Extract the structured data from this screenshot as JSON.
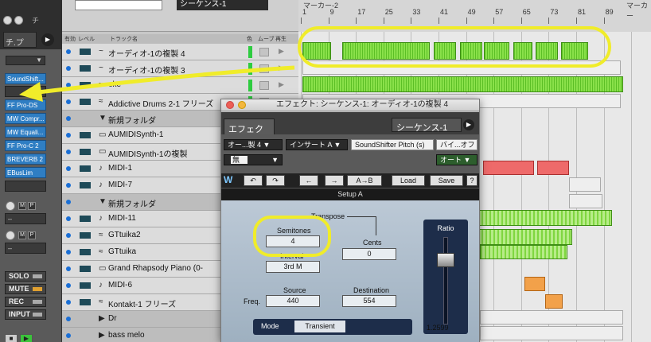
{
  "inspector": {
    "title": "チ",
    "tab_label": "チ.プ",
    "tab_btn": "▶",
    "dropdown": "▼",
    "plugins": [
      "SoundShift...",
      "FF Pro-DS",
      "MW Compr...",
      "MW Equali...",
      "FF Pro-C 2",
      "BREVERB 2",
      "EBusLim"
    ],
    "mini_buttons": [
      "M",
      "P"
    ],
    "dash_fields": [
      "–",
      "–"
    ],
    "status_buttons": [
      "SOLO",
      "MUTE",
      "REC",
      "INPUT"
    ],
    "transport": [
      "■",
      "▶"
    ]
  },
  "topbar": {
    "sequence": "シーケンス-1",
    "marker1": "マーカー-2",
    "marker2": "マーカー"
  },
  "ruler": {
    "bars": [
      "1",
      "9",
      "17",
      "25",
      "33",
      "41",
      "49",
      "57",
      "65",
      "73",
      "81",
      "89"
    ]
  },
  "columns": {
    "active": "有効",
    "level": "レベル",
    "name": "トラック名",
    "color": "色",
    "move": "ムーブ",
    "play": "再生"
  },
  "tracks": [
    {
      "icon": "~",
      "name": "オーディオ-1の複製 4",
      "folder": false
    },
    {
      "icon": "~",
      "name": "オーディオ-1の複製 3",
      "folder": false
    },
    {
      "icon": "≈",
      "name": "oke",
      "folder": false
    },
    {
      "icon": "≈",
      "name": "Addictive Drums 2-1 フリーズ",
      "folder": false
    },
    {
      "icon": "▼",
      "name": "新規フォルダ",
      "folder": true
    },
    {
      "icon": "▭",
      "name": "AUMIDISynth-1",
      "folder": false
    },
    {
      "icon": "▭",
      "name": "AUMIDISynth-1の複製",
      "folder": false
    },
    {
      "icon": "♪",
      "name": "MIDI-1",
      "folder": false
    },
    {
      "icon": "♪",
      "name": "MIDI-7",
      "folder": false
    },
    {
      "icon": "▼",
      "name": "新規フォルダ",
      "folder": true
    },
    {
      "icon": "♪",
      "name": "MIDI-11",
      "folder": false
    },
    {
      "icon": "≈",
      "name": "GTtuika2",
      "folder": false
    },
    {
      "icon": "≈",
      "name": "GTtuika",
      "folder": false
    },
    {
      "icon": "▭",
      "name": "Grand Rhapsody Piano (0-",
      "folder": false
    },
    {
      "icon": "♪",
      "name": "MIDI-6",
      "folder": false
    },
    {
      "icon": "≈",
      "name": "Kontakt-1 フリーズ",
      "folder": false
    },
    {
      "icon": "▶",
      "name": "Dr",
      "folder": true
    },
    {
      "icon": "▶",
      "name": "bass melo",
      "folder": true
    }
  ],
  "effect_window": {
    "title": "エフェクト: シーケンス-1: オーディオ-1の複製 4",
    "tab": "エフェクト",
    "sequence": "シーケンス-1 ▼",
    "seq_btn": "▶",
    "slot": "オー...製 4 ▼",
    "insert": "インサート A ▼",
    "plugin": "SoundShifter Pitch (s)",
    "bypass": "バイ...オフ",
    "preset": "無",
    "preset_arrow": "▼",
    "auto": "オート ▼",
    "waves_logo": "W",
    "toolbar": [
      "↶",
      "↷",
      "←",
      "→",
      "A→B",
      "Load",
      "Save",
      "?"
    ],
    "setup": "Setup A"
  },
  "plugin": {
    "transpose_label": "Transpose",
    "semitones_label": "Semitones",
    "semitones_value": "4",
    "interval_label": "Interval",
    "interval_value": "3rd M",
    "cents_label": "Cents",
    "cents_value": "0",
    "ratio_label": "Ratio",
    "ratio_value": "1.2599",
    "source_label": "Source",
    "freq_label": "Freq.",
    "source_value": "440",
    "destination_label": "Destination",
    "destination_value": "554",
    "mode_label": "Mode",
    "mode_value": "Transient"
  },
  "colors": {
    "accent_blue": "#2f7ec3",
    "clip_green": "#7bd93b",
    "highlight_yellow": "#f0ec2a"
  }
}
